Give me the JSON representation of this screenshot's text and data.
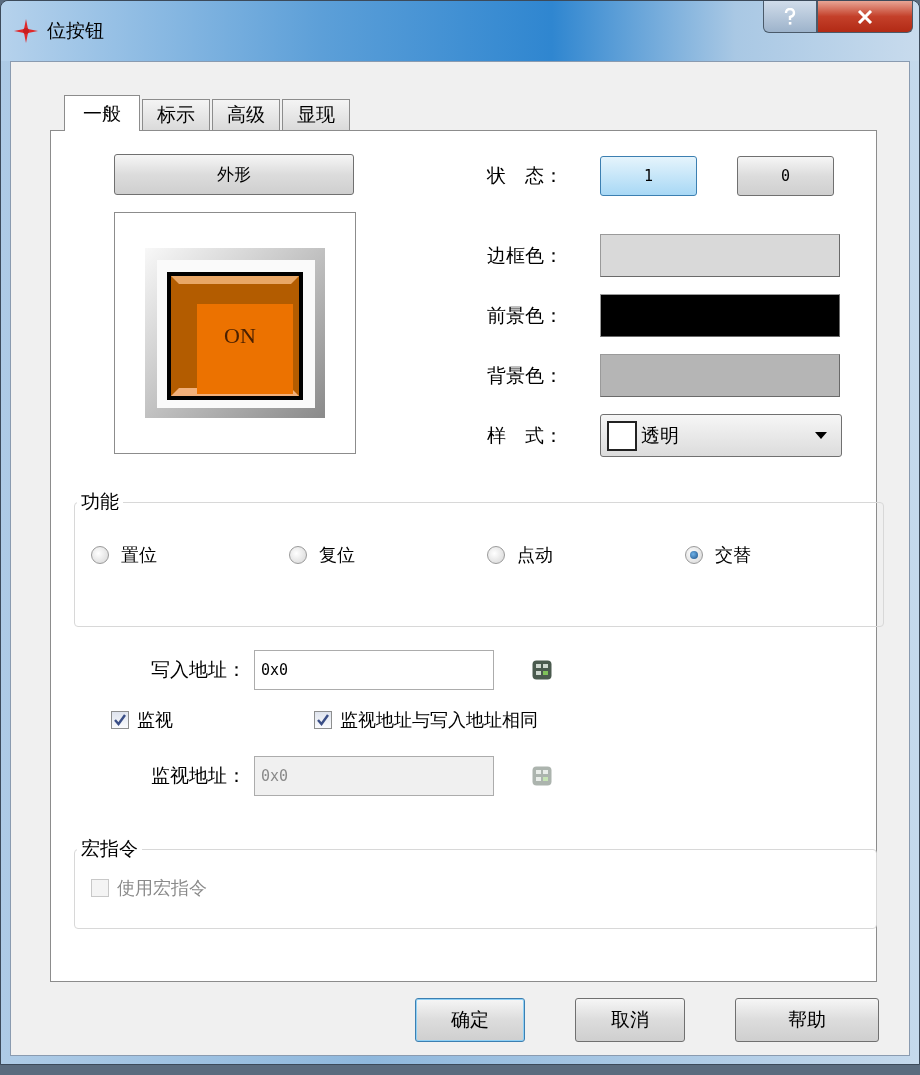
{
  "window": {
    "title": "位按钮"
  },
  "tabs": [
    {
      "label": "一般",
      "selected": true
    },
    {
      "label": "标示",
      "selected": false
    },
    {
      "label": "高级",
      "selected": false
    },
    {
      "label": "显现",
      "selected": false
    }
  ],
  "appearance_button": "外形",
  "preview": {
    "label": "ON"
  },
  "state": {
    "label": "状　态：",
    "options": [
      {
        "label": "1",
        "selected": true
      },
      {
        "label": "0",
        "selected": false
      }
    ]
  },
  "colors": [
    {
      "label": "边框色：",
      "color": "#d9d9d9"
    },
    {
      "label": "前景色：",
      "color": "#000000"
    },
    {
      "label": "背景色：",
      "color": "#b5b5b5"
    }
  ],
  "style": {
    "label": "样　式：",
    "value": "透明"
  },
  "function": {
    "title": "功能",
    "options": [
      {
        "label": "置位",
        "selected": false
      },
      {
        "label": "复位",
        "selected": false
      },
      {
        "label": "点动",
        "selected": false
      },
      {
        "label": "交替",
        "selected": true
      }
    ]
  },
  "write_address": {
    "label": "写入地址：",
    "value": "0x0",
    "disabled": false
  },
  "monitor": {
    "label": "监视",
    "checked": true
  },
  "same_address": {
    "label": "监视地址与写入地址相同",
    "checked": true
  },
  "monitor_address": {
    "label": "监视地址：",
    "value": "0x0",
    "disabled": true
  },
  "macro": {
    "title": "宏指令",
    "use": {
      "label": "使用宏指令",
      "checked": false,
      "disabled": true
    }
  },
  "buttons": [
    {
      "label": "确定",
      "default": true
    },
    {
      "label": "取消",
      "default": false
    },
    {
      "label": "帮助",
      "default": false
    }
  ]
}
